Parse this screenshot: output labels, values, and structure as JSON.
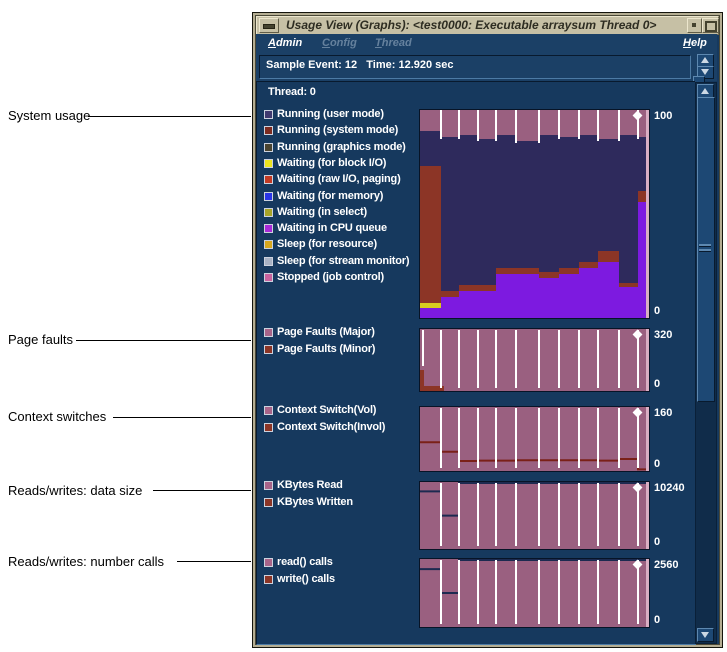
{
  "window": {
    "title": "Usage View (Graphs): <test0000: Executable arraysum Thread 0>",
    "menus": [
      {
        "label": "Admin",
        "enabled": true
      },
      {
        "label": "Config",
        "enabled": false
      },
      {
        "label": "Thread",
        "enabled": false
      }
    ],
    "help_menu": "Help",
    "sample_bar": "Sample Event: 12   Time: 12.920 sec",
    "thread_label": "Thread: 0"
  },
  "callouts": [
    {
      "label": "System usage"
    },
    {
      "label": "Page faults"
    },
    {
      "label": "Context switches"
    },
    {
      "label": "Reads/writes: data size"
    },
    {
      "label": "Reads/writes: number calls"
    }
  ],
  "colors": {
    "window_bg": "#16395e",
    "titlebar_bg": "#c6c0a5",
    "frame_tan": "#b5ae93",
    "chart_mauve": "#9a6080",
    "chart_navy": "#2e2a5c",
    "chart_purple": "#7d1ae0",
    "chart_red": "#8c3526",
    "chart_yellow": "#d8cc20",
    "chart_bg_strip": "#d9aec3",
    "line_red": "#7a2018",
    "line_navy": "#1c2a50",
    "separator": "#ffffff",
    "swatch_major": "#a86489",
    "swatch_minor": "#8c3526"
  },
  "usage_legend": [
    {
      "label": "Running (user mode)",
      "color": "#403a70"
    },
    {
      "label": "Running (system mode)",
      "color": "#7d2b20"
    },
    {
      "label": "Running (graphics mode)",
      "color": "#4a4430"
    },
    {
      "label": "Waiting (for block I/O)",
      "color": "#ede41f"
    },
    {
      "label": "Waiting (raw I/O, paging)",
      "color": "#c23a24"
    },
    {
      "label": "Waiting (for memory)",
      "color": "#2a35e8"
    },
    {
      "label": "Waiting (in select)",
      "color": "#a8a428"
    },
    {
      "label": "Waiting in CPU queue",
      "color": "#a82ad8"
    },
    {
      "label": "Sleep (for resource)",
      "color": "#d8a81f"
    },
    {
      "label": "Sleep (for stream monitor)",
      "color": "#a8b2c4"
    },
    {
      "label": "Stopped (job control)",
      "color": "#c8639f"
    }
  ],
  "chart_data": [
    {
      "id": "system-usage",
      "type": "area",
      "title": "System usage",
      "ylim": [
        0,
        100
      ],
      "yticks": [
        "100",
        "0"
      ],
      "boundaries": [
        0,
        21,
        39,
        58,
        76,
        96,
        119,
        139,
        159,
        178,
        199,
        218,
        226
      ],
      "segment_keys": [
        "chart_purple",
        "chart_yellow",
        "chart_red",
        "chart_navy",
        "chart_mauve"
      ],
      "segment_names": [
        "waiting-cpu-queue",
        "waiting-block-io",
        "running-system",
        "running-user",
        "top-band"
      ],
      "columns": [
        [
          5,
          2,
          66,
          17,
          10
        ],
        [
          10,
          0,
          3,
          74,
          13
        ],
        [
          13,
          0,
          3,
          72,
          12
        ],
        [
          13,
          0,
          3,
          70,
          14
        ],
        [
          21,
          0,
          3,
          64,
          12
        ],
        [
          21,
          0,
          3,
          61,
          15
        ],
        [
          19,
          0,
          3,
          66,
          12
        ],
        [
          21,
          0,
          3,
          63,
          13
        ],
        [
          24,
          0,
          3,
          61,
          12
        ],
        [
          27,
          0,
          5,
          54,
          14
        ],
        [
          15,
          0,
          2,
          71,
          12
        ],
        [
          56,
          0,
          5,
          26,
          13
        ]
      ],
      "separators": "band"
    },
    {
      "id": "page-faults",
      "type": "area",
      "title": "Page faults",
      "ylim": [
        0,
        320
      ],
      "yticks": [
        "320",
        "0"
      ],
      "legend": [
        {
          "label": "Page Faults (Major)",
          "color_key": "swatch_major"
        },
        {
          "label": "Page Faults (Minor)",
          "color_key": "swatch_minor"
        }
      ],
      "fill": "chart_mauve",
      "minor_rects": [
        {
          "x": 0,
          "w": 4,
          "value": 108
        },
        {
          "x": 0,
          "w": 24,
          "value": 24
        }
      ],
      "left_partial_separator": true,
      "separators": "full"
    },
    {
      "id": "context-switches",
      "type": "area",
      "title": "Context switches",
      "ylim": [
        0,
        160
      ],
      "yticks": [
        "160",
        "0"
      ],
      "legend": [
        {
          "label": "Context Switch(Vol)",
          "color_key": "swatch_major"
        },
        {
          "label": "Context Switch(Invol)",
          "color_key": "swatch_minor"
        }
      ],
      "fill": "chart_mauve",
      "line": {
        "color_key": "line_red",
        "values": [
          72,
          48,
          25,
          26,
          26,
          27,
          27,
          27,
          27,
          26,
          30,
          4
        ]
      },
      "separators": "full"
    },
    {
      "id": "kbytes",
      "type": "area",
      "title": "Reads/writes: data size",
      "ylim": [
        0,
        10240
      ],
      "yticks": [
        "10240",
        "0"
      ],
      "legend": [
        {
          "label": "KBytes Read",
          "color_key": "swatch_major"
        },
        {
          "label": "KBytes Written",
          "color_key": "swatch_minor"
        }
      ],
      "fill": "chart_mauve",
      "line": {
        "color_key": "line_navy",
        "values": [
          8800,
          5100,
          10240,
          10240,
          10240,
          10240,
          10240,
          10240,
          10240,
          10240,
          10240,
          10240
        ]
      },
      "separators": "full"
    },
    {
      "id": "calls",
      "type": "area",
      "title": "Reads/writes: number calls",
      "ylim": [
        0,
        2560
      ],
      "yticks": [
        "2560",
        "0"
      ],
      "legend": [
        {
          "label": "read() calls",
          "color_key": "swatch_major"
        },
        {
          "label": "write() calls",
          "color_key": "swatch_minor"
        }
      ],
      "fill": "chart_mauve",
      "line": {
        "color_key": "line_navy",
        "values": [
          2180,
          1280,
          2560,
          2560,
          2560,
          2560,
          2560,
          2560,
          2560,
          2560,
          2560,
          2560
        ]
      },
      "separators": "full"
    }
  ]
}
